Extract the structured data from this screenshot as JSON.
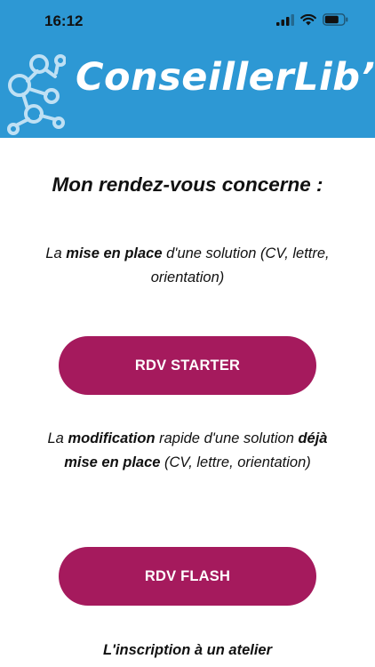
{
  "status_bar": {
    "time": "16:12"
  },
  "header": {
    "app_title": "ConseillerLib’",
    "background_color": "#2d98d4",
    "logo_icon": "people-network-icon"
  },
  "main": {
    "heading": "Mon rendez-vous concerne :",
    "options": [
      {
        "description_parts": [
          {
            "text": "La ",
            "bold": false
          },
          {
            "text": "mise en place",
            "bold": true
          },
          {
            "text": " d'une solution (CV, lettre, orientation)",
            "bold": false
          }
        ],
        "button_label": "RDV STARTER"
      },
      {
        "description_parts": [
          {
            "text": "La ",
            "bold": false
          },
          {
            "text": "modification",
            "bold": true
          },
          {
            "text": " rapide d'une solution ",
            "bold": false
          },
          {
            "text": "déjà mise en place",
            "bold": true
          },
          {
            "text": " (CV, lettre, orientation)",
            "bold": false
          }
        ],
        "button_label": "RDV FLASH"
      }
    ],
    "footer_text": "L'inscription à un atelier"
  },
  "colors": {
    "button": "#a51a5d",
    "button_text": "#ffffff"
  }
}
